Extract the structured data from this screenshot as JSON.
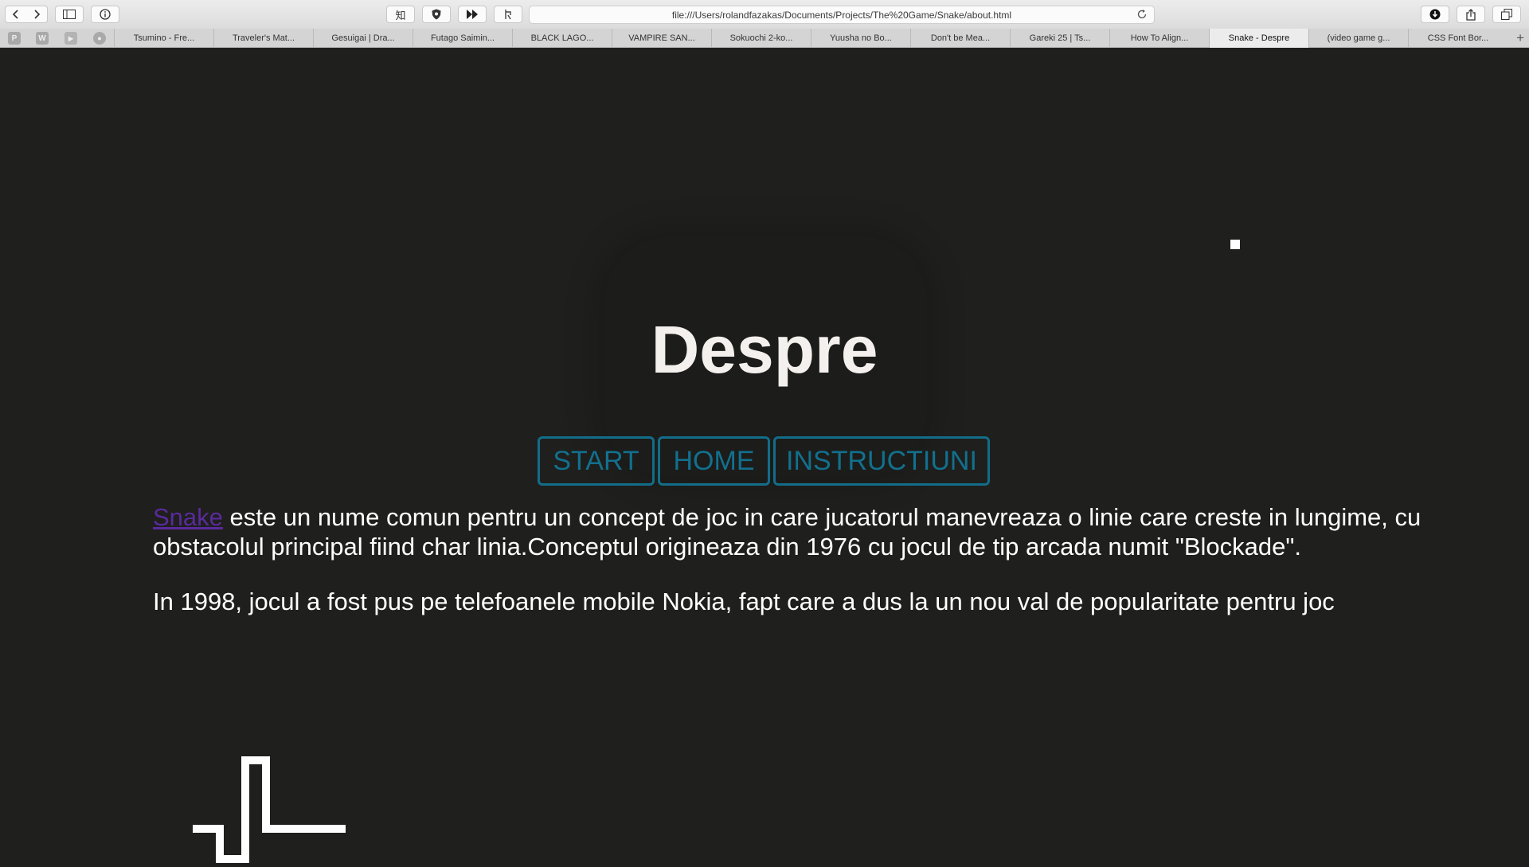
{
  "browser": {
    "address": "file:///Users/rolandfazakas/Documents/Projects/The%20Game/Snake/about.html",
    "tabs": [
      {
        "label": "Tsumino - Fre..."
      },
      {
        "label": "Traveler's Mat..."
      },
      {
        "label": "Gesuigai | Dra..."
      },
      {
        "label": "Futago Saimin..."
      },
      {
        "label": "BLACK LAGO..."
      },
      {
        "label": "VAMPIRE SAN..."
      },
      {
        "label": "Sokuochi 2-ko..."
      },
      {
        "label": "Yuusha no Bo..."
      },
      {
        "label": "Don't be Mea..."
      },
      {
        "label": "Gareki 25 | Ts..."
      },
      {
        "label": "How To Align..."
      },
      {
        "label": "Snake - Despre",
        "active": true
      },
      {
        "label": "(video game g..."
      },
      {
        "label": "CSS Font Bor..."
      }
    ],
    "pinned": [
      {
        "icon": "p-favicon-icon",
        "glyph": "P"
      },
      {
        "icon": "w-favicon-icon",
        "glyph": "W"
      },
      {
        "icon": "youtube-favicon-icon",
        "glyph": "▶"
      },
      {
        "icon": "github-favicon-icon",
        "glyph": "●"
      }
    ],
    "translate_label": "知"
  },
  "page": {
    "title": "Despre",
    "nav": [
      "START",
      "HOME",
      "INSTRUCTIUNI"
    ],
    "paragraph1_link": "Snake",
    "paragraph1_rest": " este un nume comun pentru un concept de joc in care jucatorul manevreaza o linie care creste in lungime, cu obstacolul principal fiind char linia.Conceptul origineaza din 1976 cu jocul de tip arcada numit \"Blockade\".",
    "paragraph2": "In 1998, jocul a fost pus pe telefoanele mobile Nokia, fapt care a dus la un nou val de popularitate pentru joc"
  },
  "colors": {
    "background": "#1f1f1d",
    "button_border": "#126d8a",
    "button_text": "#12708e",
    "link": "#5a2a9c",
    "title": "#f4f0ee"
  }
}
